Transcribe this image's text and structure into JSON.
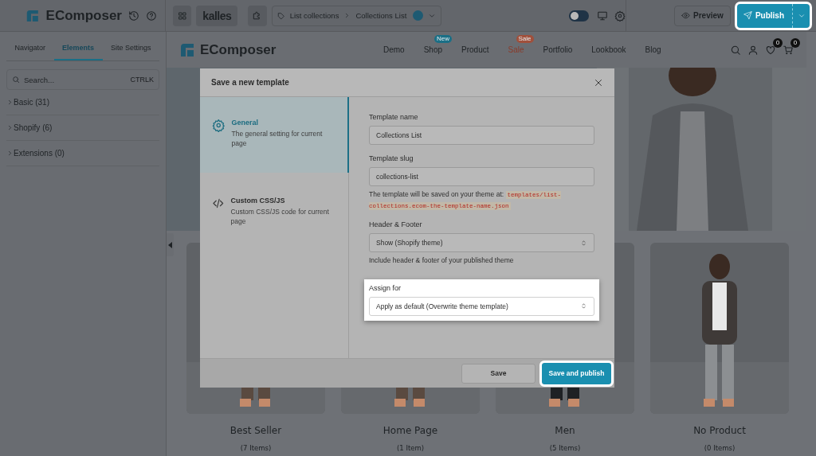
{
  "topbar": {
    "logo": "EComposer",
    "theme": "kalles",
    "breadcrumb": [
      "List collections",
      "Collections List"
    ],
    "dark_mode": false,
    "preview": "Preview",
    "publish": {
      "label": "Publish",
      "highlighted": true
    }
  },
  "sidebar": {
    "tabs": [
      {
        "label": "Navigator",
        "selected": false
      },
      {
        "label": "Elements",
        "selected": true
      },
      {
        "label": "Site Settings",
        "selected": false
      }
    ],
    "search": {
      "placeholder": "Search...",
      "shortcut": "CTRLK"
    },
    "groups": [
      {
        "label": "Basic (31)",
        "expanded": false
      },
      {
        "label": "Shopify (6)",
        "expanded": false
      },
      {
        "label": "Extensions (0)",
        "expanded": false
      }
    ]
  },
  "store": {
    "logo": "EComposer",
    "nav": [
      {
        "label": "Demo"
      },
      {
        "label": "Shop",
        "badge": {
          "text": "New",
          "color": "#1b6f86"
        }
      },
      {
        "label": "Product"
      },
      {
        "label": "Sale",
        "badge": {
          "text": "Sale",
          "color": "#a0503c"
        },
        "color": "#8a3b2a"
      },
      {
        "label": "Portfolio"
      },
      {
        "label": "Lookbook"
      },
      {
        "label": "Blog"
      }
    ],
    "wishlist_count": "0",
    "cart_count": "0",
    "collections": [
      {
        "title": "Best Seller",
        "count": "(7 Items)"
      },
      {
        "title": "Home Page",
        "count": "(1 Item)"
      },
      {
        "title": "Men",
        "count": "(5 Items)"
      },
      {
        "title": "No Product",
        "count": "(0 Items)"
      }
    ]
  },
  "modal": {
    "title": "Save a new template",
    "sections": [
      {
        "kind": "settings",
        "title": "General",
        "description": "The general setting for current page",
        "selected": true
      },
      {
        "kind": "code",
        "title": "Custom CSS/JS",
        "description": "Custom CSS/JS code for current page",
        "selected": false
      }
    ],
    "fields": [
      {
        "kind": "text",
        "label": "Template name",
        "value": "Collections List",
        "highlighted": false
      },
      {
        "kind": "text",
        "label": "Template slug",
        "value": "collections-list",
        "help": "The template will be saved on your theme at:",
        "help_code": "templates/list-collections.ecom-the-template-name.json",
        "highlighted": false
      },
      {
        "kind": "select",
        "label": "Header & Footer",
        "value": "Show (Shopify theme)",
        "help": "Include header & footer of your published theme",
        "highlighted": false
      },
      {
        "kind": "select",
        "label": "Assign for",
        "value": "Apply as default (Overwrite theme template)",
        "highlighted": true
      }
    ],
    "buttons": [
      {
        "label": "Save",
        "primary": false,
        "highlighted": false
      },
      {
        "label": "Save and publish",
        "primary": true,
        "highlighted": true
      }
    ]
  }
}
